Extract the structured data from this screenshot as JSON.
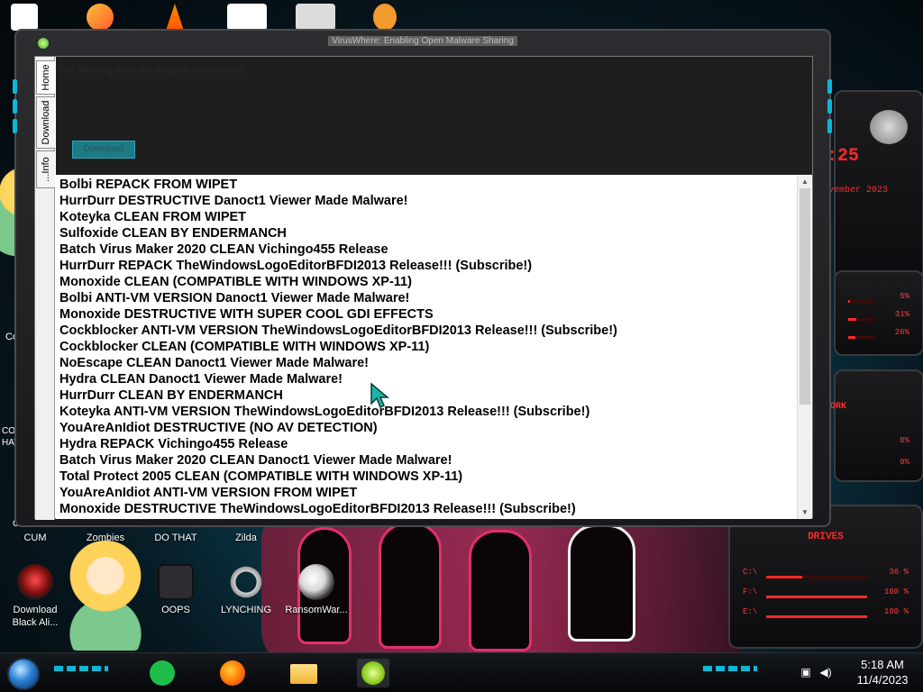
{
  "window": {
    "title": "VirusWhere: Enabling Open Malware Sharing",
    "tabs": [
      {
        "label": "Home"
      },
      {
        "label": "Download"
      },
      {
        "label": "...Info"
      }
    ],
    "intro": "The following items are available for download.",
    "download_button": "Download",
    "items": [
      "Bolbi REPACK FROM WIPET",
      "HurrDurr DESTRUCTIVE Danoct1 Viewer Made Malware!",
      "Koteyka CLEAN FROM WIPET",
      "Sulfoxide CLEAN BY ENDERMANCH",
      "Batch Virus Maker 2020 CLEAN Vichingo455 Release",
      "HurrDurr REPACK TheWindowsLogoEditorBFDI2013 Release!!! (Subscribe!)",
      "Monoxide CLEAN (COMPATIBLE WITH WINDOWS XP-11)",
      "Bolbi ANTI-VM VERSION Danoct1 Viewer Made Malware!",
      "Monoxide DESTRUCTIVE WITH SUPER COOL GDI EFFECTS",
      "Cockblocker ANTI-VM VERSION TheWindowsLogoEditorBFDI2013 Release!!! (Subscribe!)",
      "Cockblocker CLEAN (COMPATIBLE WITH WINDOWS XP-11)",
      "NoEscape CLEAN Danoct1 Viewer Made Malware!",
      "Hydra CLEAN Danoct1 Viewer Made Malware!",
      "HurrDurr CLEAN BY ENDERMANCH",
      "Koteyka ANTI-VM VERSION TheWindowsLogoEditorBFDI2013 Release!!! (Subscribe!)",
      "YouAreAnIdiot DESTRUCTIVE (NO AV DETECTION)",
      "Hydra REPACK Vichingo455 Release",
      "Batch Virus Maker 2020 CLEAN Danoct1 Viewer Made Malware!",
      "Total Protect 2005 CLEAN (COMPATIBLE WITH WINDOWS XP-11)",
      "YouAreAnIdiot ANTI-VM VERSION FROM WIPET",
      "Monoxide DESTRUCTIVE TheWindowsLogoEditorBFDI2013 Release!!! (Subscribe!)"
    ]
  },
  "desktop_icons": [
    {
      "label": "CUM",
      "icon": "app-icon"
    },
    {
      "label": "Zombies",
      "icon": "star-butterfly-icon"
    },
    {
      "label": "DO THAT",
      "icon": "app-icon"
    },
    {
      "label": "Zilda",
      "icon": "app-icon"
    },
    {
      "label": "Download Black Ali...",
      "icon": "alienware-icon"
    },
    {
      "label": "OOPS",
      "icon": "oops-icon"
    },
    {
      "label": "LYNCHING",
      "icon": "noose-icon"
    },
    {
      "label": "RansomWar...",
      "icon": "skull-icon"
    }
  ],
  "side_fragments": {
    "co": "Co",
    "con_hat": "CON\nHAT",
    "ci": "Ci"
  },
  "widgets": {
    "time_fragment": ":25",
    "date_fragment": "vember 2023",
    "stats": [
      "5%",
      "31%",
      "26%"
    ],
    "network": "ORK",
    "net_values": [
      "0%",
      "0%"
    ],
    "drives_title": "DRIVES",
    "drives": [
      {
        "label": "C:\\",
        "value": "36 %"
      },
      {
        "label": "F:\\",
        "value": "100 %"
      },
      {
        "label": "E:\\",
        "value": "100 %"
      }
    ]
  },
  "taskbar": {
    "apps": [
      "notes-icon",
      "firefox-icon",
      "file-explorer-icon",
      "lime-app-icon"
    ],
    "clock_time": "5:18 AM",
    "clock_date": "11/4/2023"
  },
  "colors": {
    "accent_cyan": "#0fb6d6",
    "widget_red": "#ff2a2a",
    "window_frame": "#2d2d30"
  }
}
